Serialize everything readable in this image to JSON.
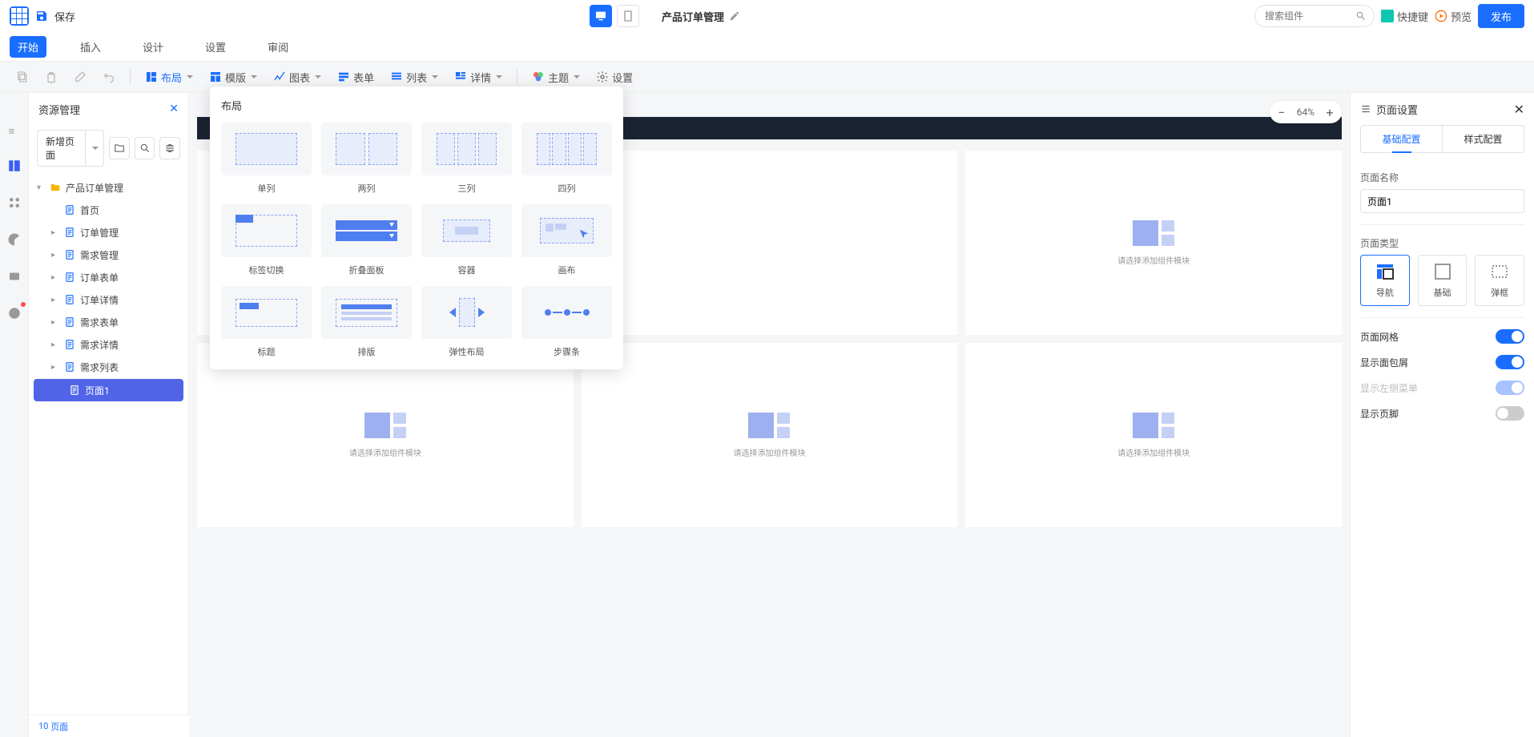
{
  "topbar": {
    "save_label": "保存",
    "app_title": "产品订单管理",
    "search_placeholder": "搜索组件",
    "shortcut_label": "快捷键",
    "preview_label": "预览",
    "publish_label": "发布"
  },
  "menubar": {
    "tabs": [
      "开始",
      "插入",
      "设计",
      "设置",
      "审阅"
    ],
    "active": 0
  },
  "toolbar": {
    "layout_label": "布局",
    "template_label": "模版",
    "chart_label": "图表",
    "form_label": "表单",
    "list_label": "列表",
    "detail_label": "详情",
    "theme_label": "主题",
    "settings_label": "设置"
  },
  "left_panel": {
    "title": "资源管理",
    "new_page_label": "新增页面",
    "tree": {
      "root": "产品订单管理",
      "items": [
        "首页",
        "订单管理",
        "需求管理",
        "订单表单",
        "订单详情",
        "需求表单",
        "需求详情",
        "需求列表",
        "页面1"
      ],
      "selected": "页面1"
    }
  },
  "footer": {
    "page_count": "10",
    "page_label": "页面"
  },
  "canvas": {
    "zoom": "64%",
    "cell_hint": "请选择添加组件模块"
  },
  "popover": {
    "title": "布局",
    "items": [
      "单列",
      "两列",
      "三列",
      "四列",
      "标签切换",
      "折叠面板",
      "容器",
      "画布",
      "标题",
      "排版",
      "弹性布局",
      "步骤条"
    ]
  },
  "right_panel": {
    "title": "页面设置",
    "tab_basic": "基础配置",
    "tab_style": "样式配置",
    "name_label": "页面名称",
    "name_value": "页面1",
    "type_label": "页面类型",
    "types": [
      "导航",
      "基础",
      "弹框"
    ],
    "grid_label": "页面网格",
    "breadcrumb_label": "显示面包屑",
    "left_menu_label": "显示左侧菜单",
    "footer_label": "显示页脚"
  }
}
